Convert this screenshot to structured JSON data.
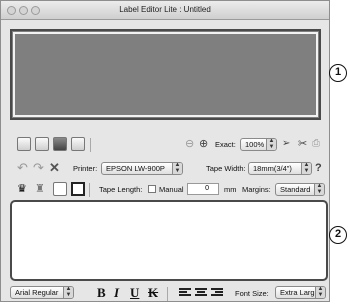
{
  "window": {
    "title": "Label Editor Lite : Untitled"
  },
  "toolbar1": {
    "zoom_out_icon": "magnifier-minus-icon",
    "zoom_in_icon": "magnifier-plus-icon",
    "exact_label": "Exact:",
    "zoom_value": "100%"
  },
  "toolbar2": {
    "printer_label": "Printer:",
    "printer_value": "EPSON LW-900P",
    "tape_width_label": "Tape Width:",
    "tape_width_value": "18mm(3/4\")"
  },
  "toolbar3": {
    "tape_length_label": "Tape Length:",
    "manual_label": "Manual",
    "length_value": "0",
    "unit": "mm",
    "margins_label": "Margins:",
    "margins_value": "Standard"
  },
  "format_bar": {
    "font_value": "Arial Regular",
    "bold": "B",
    "italic": "I",
    "underline": "U",
    "strike": "K",
    "font_size_label": "Font Size:",
    "font_size_value": "Extra Large"
  },
  "callouts": {
    "one": "1",
    "two": "2"
  }
}
